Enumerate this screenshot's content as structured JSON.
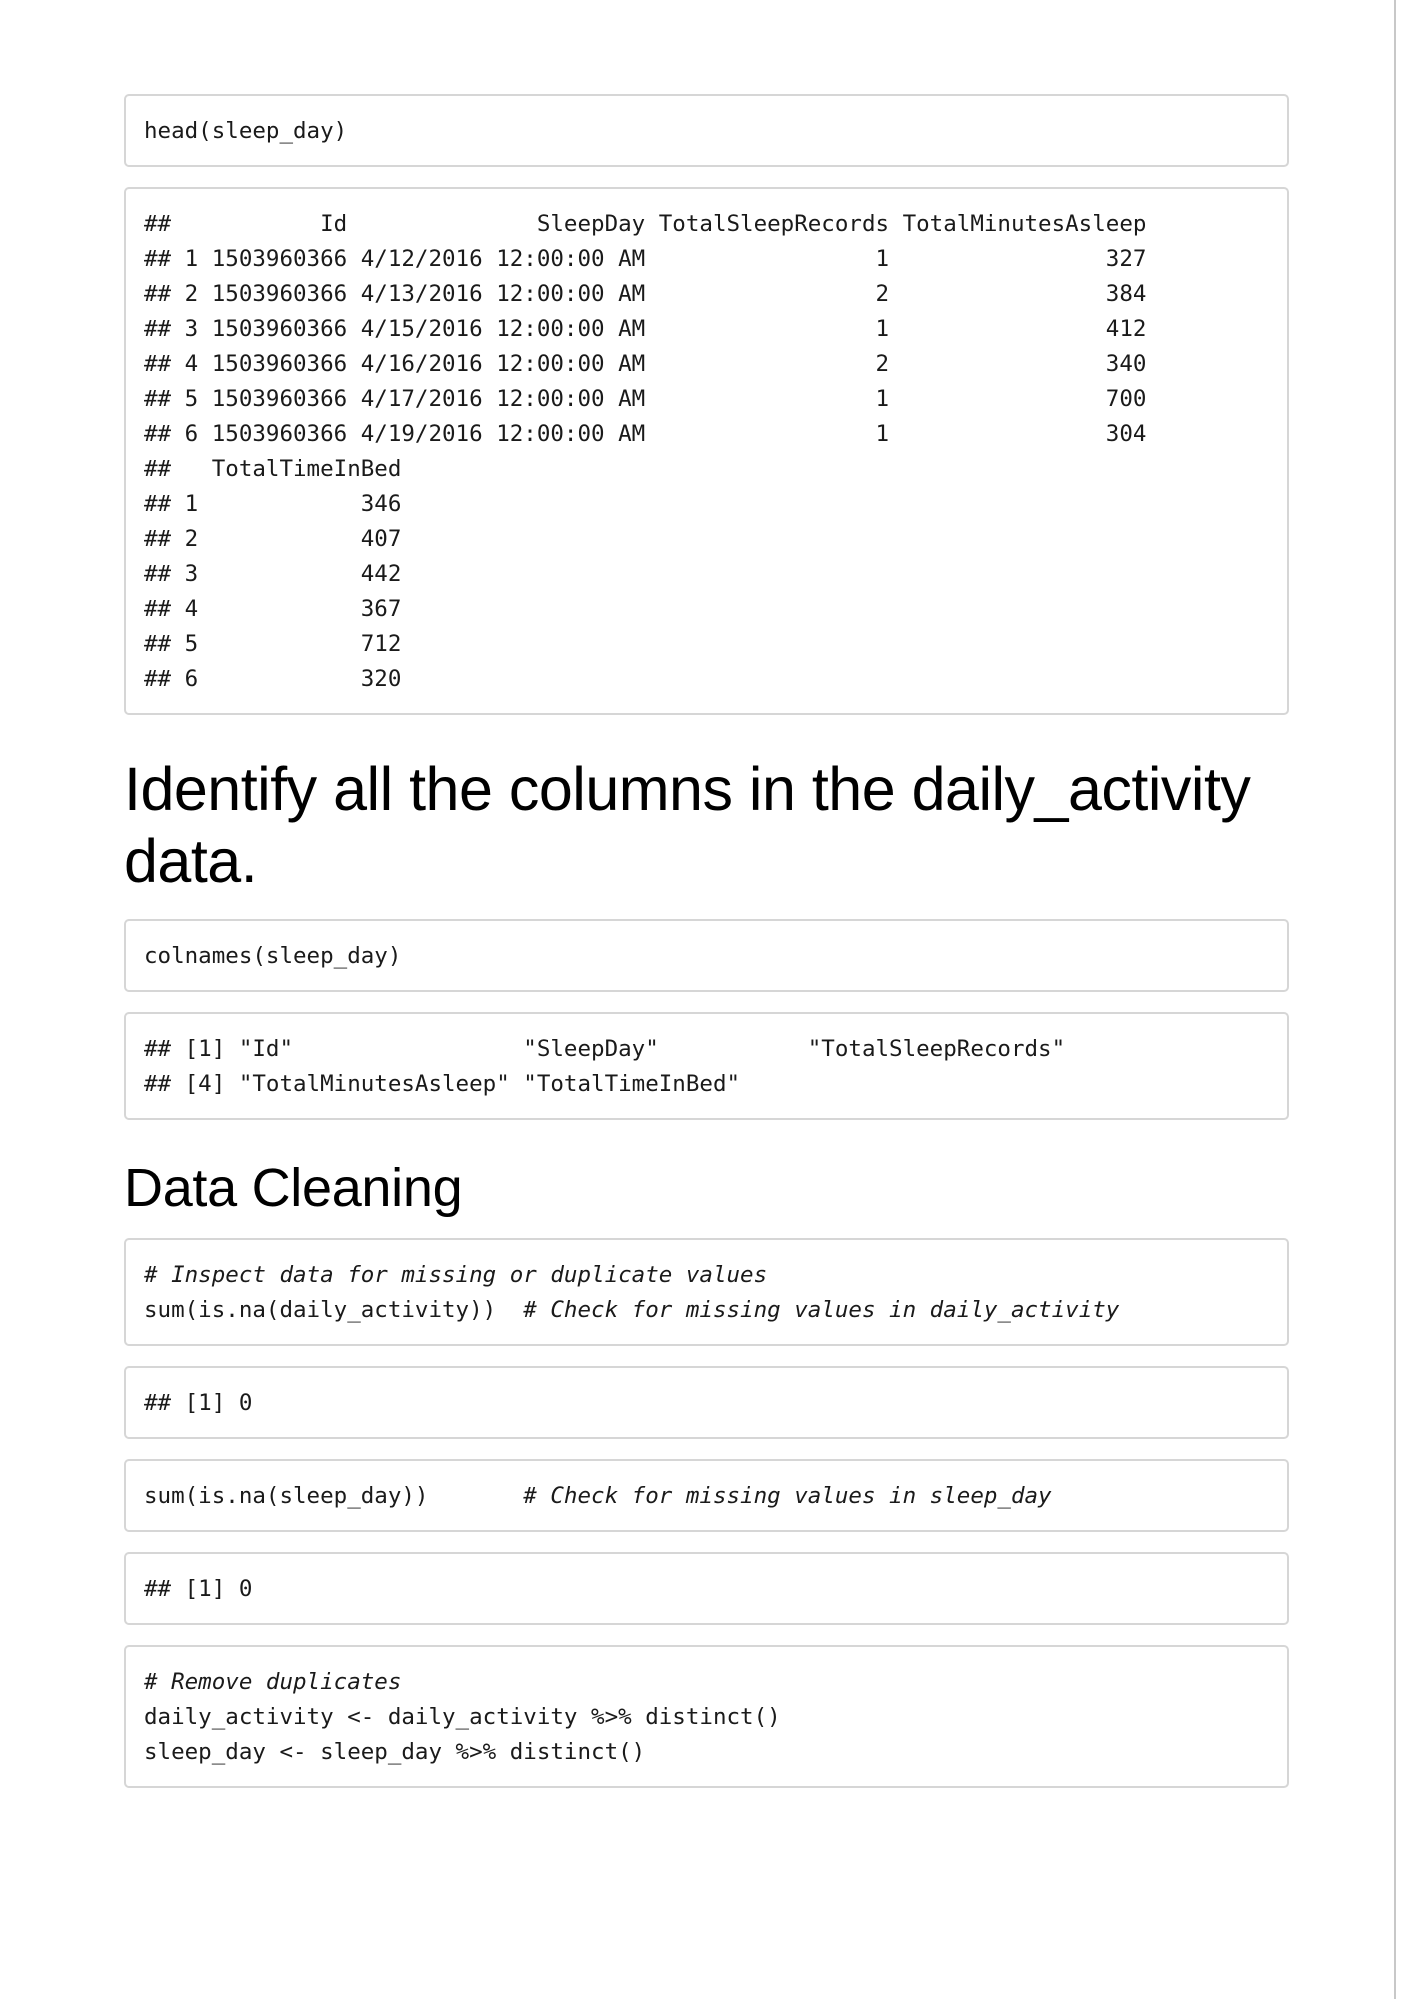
{
  "blocks": {
    "head_code": "head(sleep_day)",
    "head_output": [
      "##           Id              SleepDay TotalSleepRecords TotalMinutesAsleep",
      "## 1 1503960366 4/12/2016 12:00:00 AM                 1                327",
      "## 2 1503960366 4/13/2016 12:00:00 AM                 2                384",
      "## 3 1503960366 4/15/2016 12:00:00 AM                 1                412",
      "## 4 1503960366 4/16/2016 12:00:00 AM                 2                340",
      "## 5 1503960366 4/17/2016 12:00:00 AM                 1                700",
      "## 6 1503960366 4/19/2016 12:00:00 AM                 1                304",
      "##   TotalTimeInBed",
      "## 1            346",
      "## 2            407",
      "## 3            442",
      "## 4            367",
      "## 5            712",
      "## 6            320"
    ],
    "colnames_code": "colnames(sleep_day)",
    "colnames_output": [
      "## [1] \"Id\"                 \"SleepDay\"           \"TotalSleepRecords\"",
      "## [4] \"TotalMinutesAsleep\" \"TotalTimeInBed\""
    ],
    "na_check_comment": "# Inspect data for missing or duplicate values",
    "na_check_code": "sum(is.na(daily_activity))  ",
    "na_check_inline_comment": "# Check for missing values in daily_activity",
    "na_check_output": "## [1] 0",
    "na_sleep_code": "sum(is.na(sleep_day))       ",
    "na_sleep_inline_comment": "# Check for missing values in sleep_day",
    "na_sleep_output": "## [1] 0",
    "dedupe_comment": "# Remove duplicates",
    "dedupe_line1": "daily_activity <- daily_activity %>% distinct()",
    "dedupe_line2": "sleep_day <- sleep_day %>% distinct()"
  },
  "headings": {
    "identify_columns": "Identify all the columns in the daily_activity data.",
    "data_cleaning": "Data Cleaning"
  }
}
